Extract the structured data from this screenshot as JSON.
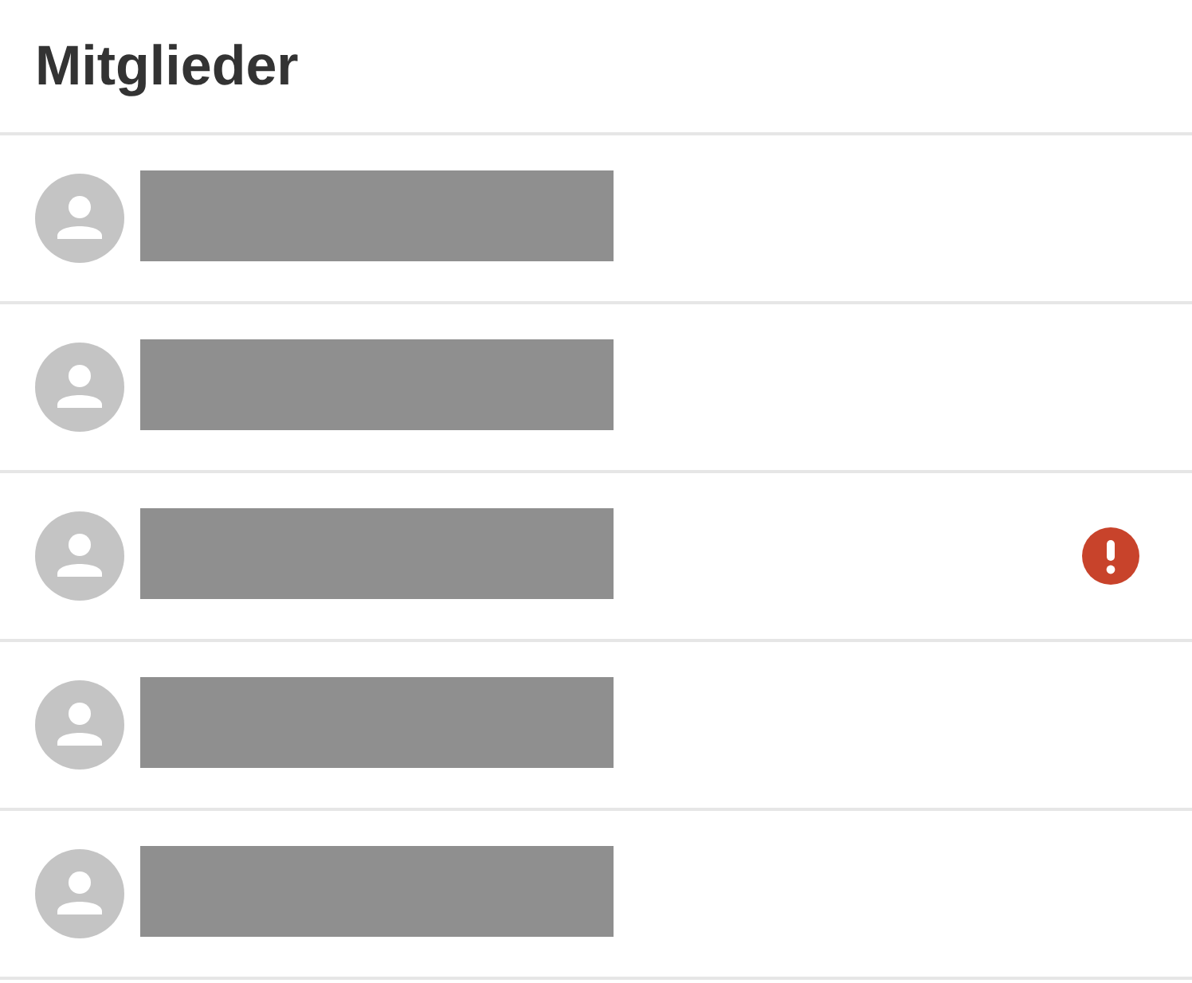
{
  "title": "Mitglieder",
  "members": [
    {
      "alert": false
    },
    {
      "alert": false
    },
    {
      "alert": true
    },
    {
      "alert": false
    },
    {
      "alert": false
    }
  ]
}
